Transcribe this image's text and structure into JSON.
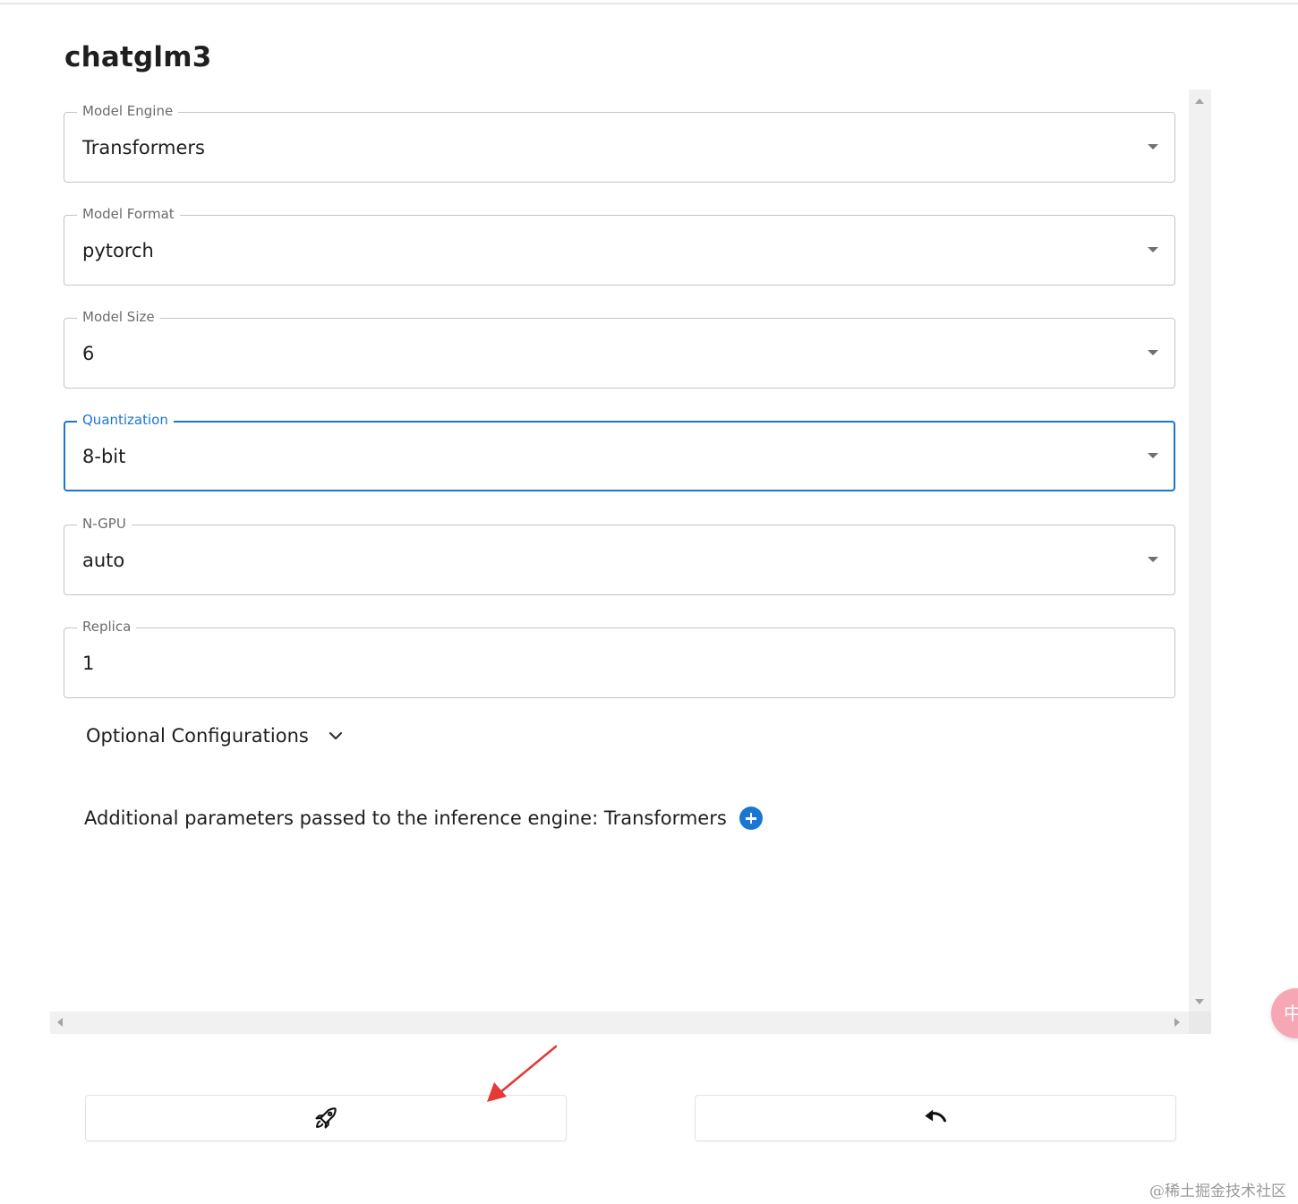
{
  "page": {
    "title": "chatglm3"
  },
  "fields": [
    {
      "label": "Model Engine",
      "value": "Transformers",
      "type": "select",
      "focused": false
    },
    {
      "label": "Model Format",
      "value": "pytorch",
      "type": "select",
      "focused": false
    },
    {
      "label": "Model Size",
      "value": "6",
      "type": "select",
      "focused": false
    },
    {
      "label": "Quantization",
      "value": "8-bit",
      "type": "select",
      "focused": true
    },
    {
      "label": "N-GPU",
      "value": "auto",
      "type": "select",
      "focused": false
    },
    {
      "label": "Replica",
      "value": "1",
      "type": "text",
      "focused": false
    }
  ],
  "optional": {
    "label": "Optional Configurations",
    "icon": "chevron-down-icon"
  },
  "additional": {
    "label": "Additional parameters passed to the inference engine: Transformers",
    "icon": "plus-circle-icon"
  },
  "actions": {
    "launch_icon": "rocket-icon",
    "back_icon": "undo-icon"
  },
  "overlay": {
    "badge_text": "中",
    "watermark": "@稀土掘金技术社区"
  },
  "colors": {
    "accent": "#1976d2",
    "annotation": "#e53935",
    "badge": "#f7a6b5"
  }
}
